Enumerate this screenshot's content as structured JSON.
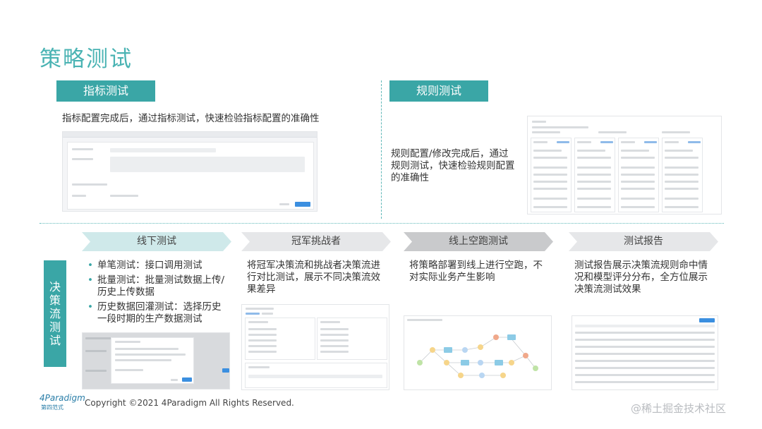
{
  "page_title": "策略测试",
  "top_left": {
    "label": "指标测试",
    "desc": "指标配置完成后，通过指标测试，快速检验指标配置的准确性"
  },
  "top_right": {
    "label": "规则测试",
    "desc": "规则配置/修改完成后，通过规则测试，快速检验规则配置的准确性"
  },
  "section_label": "决策流测试",
  "steps": [
    {
      "label": "线下测试",
      "color": "#cfe9ea"
    },
    {
      "label": "冠军挑战者",
      "color": "#e6e7e9"
    },
    {
      "label": "线上空跑测试",
      "color": "#c9cacc"
    },
    {
      "label": "测试报告",
      "color": "#e6e7e9"
    }
  ],
  "offline_bullets": [
    "单笔测试：接口调用测试",
    "批量测试：批量测试数据上传/历史上传数据",
    "历史数据回灌测试：选择历史一段时期的生产数据测试"
  ],
  "step_descs": {
    "champion": "将冠军决策流和挑战者决策流进行对比测试，展示不同决策流效果差异",
    "shadow": "将策略部署到线上进行空跑，不对实际业务产生影响",
    "report": "测试报告展示决策流规则命中情况和模型评分分布，全方位展示决策流测试效果"
  },
  "footer": {
    "logo": "4Paradigm",
    "logo_sub": "第四范式",
    "copyright": "Copyright ©2021 4Paradigm All Rights Reserved."
  },
  "watermark": "@稀土掘金技术社区",
  "colors": {
    "accent": "#3aa6a6",
    "title": "#4ab3b3",
    "button": "#3b8fe0"
  }
}
